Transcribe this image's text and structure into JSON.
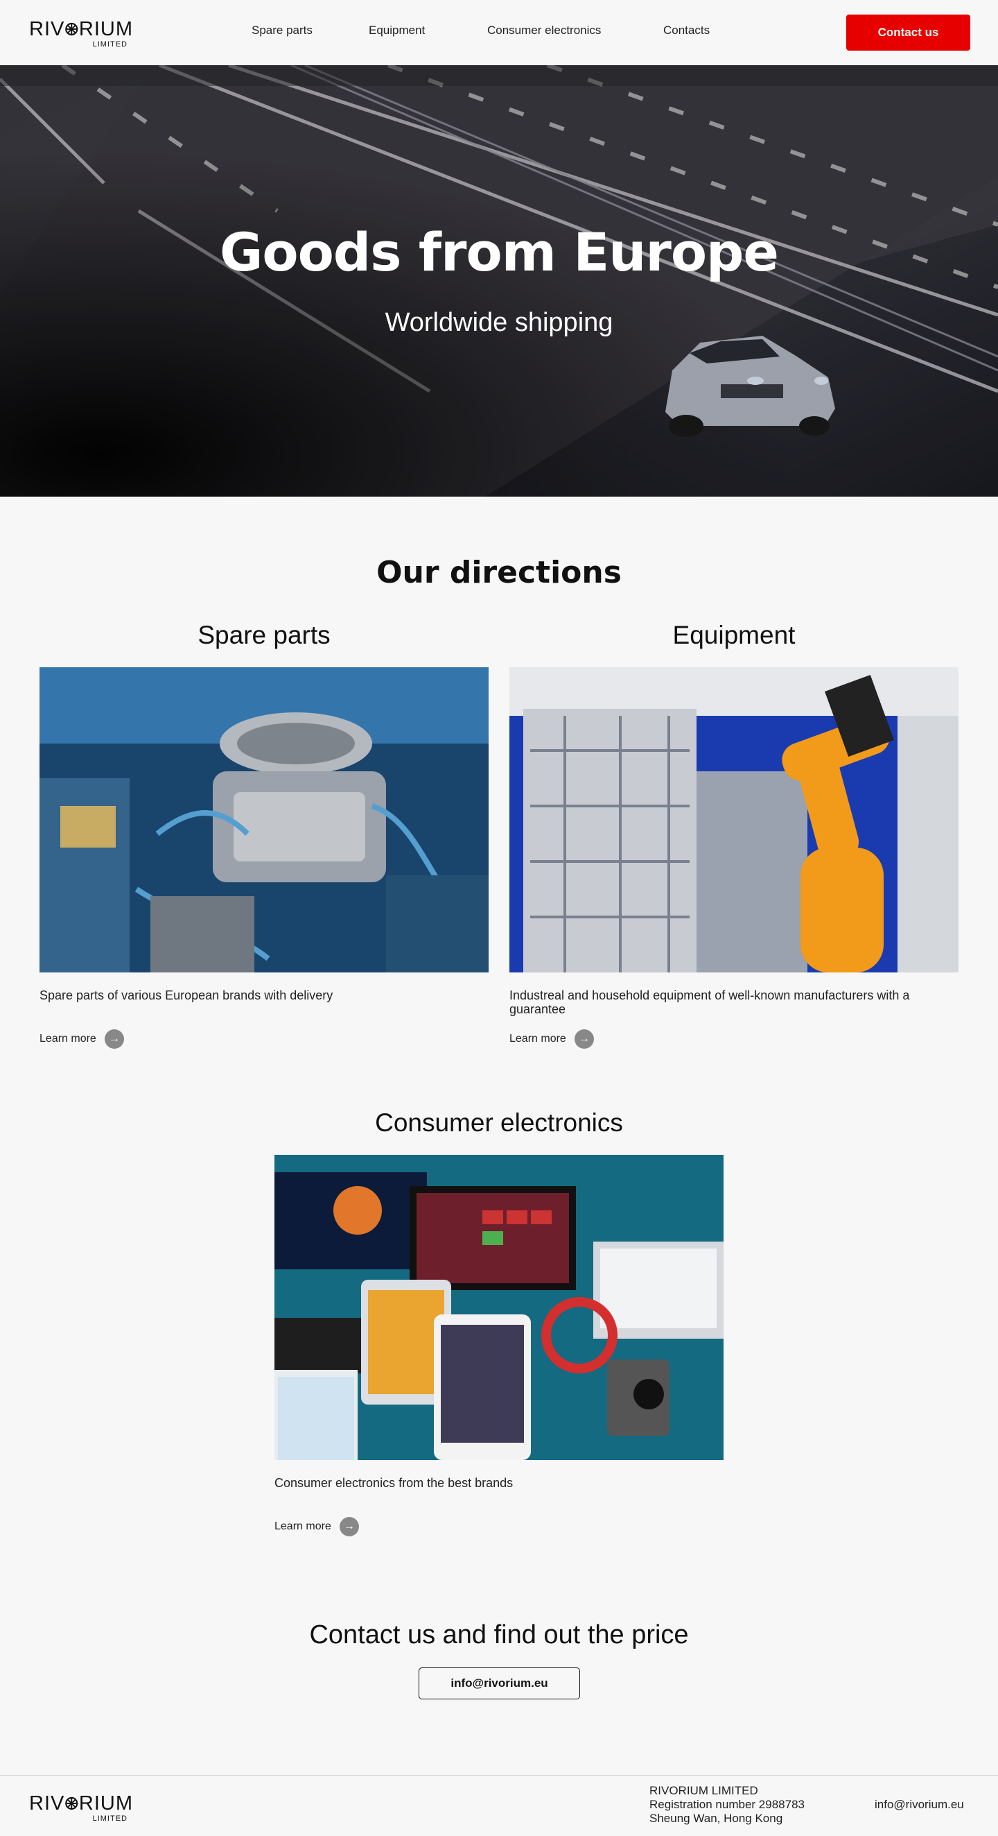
{
  "header": {
    "logo_text_1": "RIV",
    "logo_text_2": "RIUM",
    "logo_sub": "LIMITED",
    "nav": [
      "Spare parts",
      "Equipment",
      "Consumer electronics",
      "Contacts"
    ],
    "cta_label": "Contact us",
    "cta_color": "#e60000"
  },
  "hero": {
    "title": "Goods from Europe",
    "subtitle": "Worldwide shipping"
  },
  "directions": {
    "title": "Our directions",
    "cards": [
      {
        "title": "Spare parts",
        "description": "Spare parts of various European brands with delivery",
        "link": "Learn more"
      },
      {
        "title": "Equipment",
        "description": "Industreal and household equipment of well-known manufacturers with a guarantee",
        "link": "Learn more"
      },
      {
        "title": "Consumer electronics",
        "description": "Consumer electronics from the best brands",
        "link": "Learn more"
      }
    ]
  },
  "contact": {
    "title": "Contact us and find out the price",
    "email": "info@rivorium.eu"
  },
  "footer": {
    "company": "RIVORIUM LIMITED",
    "registration": "Registration number 2988783",
    "address": "Sheung Wan, Hong Kong",
    "email": "info@rivorium.eu"
  }
}
